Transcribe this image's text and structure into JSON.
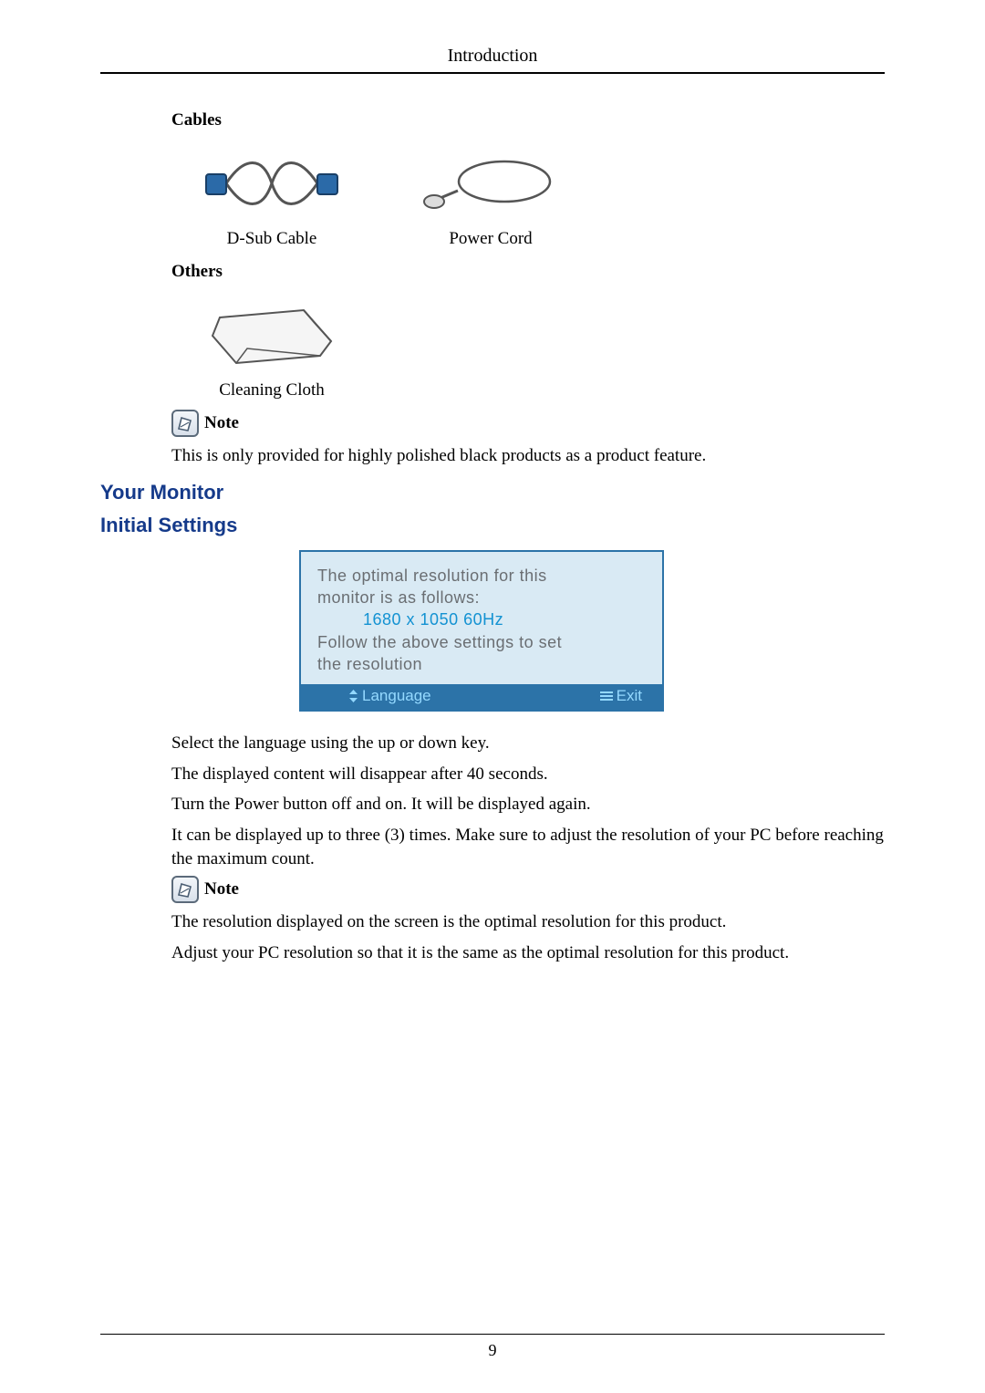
{
  "header": {
    "title": "Introduction"
  },
  "footer": {
    "page_number": "9"
  },
  "cables": {
    "heading": "Cables",
    "items": [
      {
        "caption": "D-Sub Cable"
      },
      {
        "caption": "Power Cord"
      }
    ]
  },
  "others": {
    "heading": "Others",
    "items": [
      {
        "caption": "Cleaning Cloth"
      }
    ]
  },
  "note1": {
    "label": "Note",
    "text": "This is only provided for highly polished black products as a product feature."
  },
  "h2a": "Your Monitor",
  "h2b": "Initial Settings",
  "osd": {
    "line1": "The optimal resolution for this",
    "line2": "monitor is as follows:",
    "resolution": "1680 x 1050 60Hz",
    "line3": "Follow the above settings to set",
    "line4": "the resolution",
    "footer_left": "Language",
    "footer_right": "Exit"
  },
  "paras": {
    "p1": "Select the language using the up or down key.",
    "p2": "The displayed content will disappear after 40 seconds.",
    "p3": "Turn the Power button off and on. It will be displayed again.",
    "p4": "It can be displayed up to three (3) times. Make sure to adjust the resolution of your PC before reaching the maximum count."
  },
  "note2": {
    "label": "Note",
    "text1": "The resolution displayed on the screen is the optimal resolution for this product.",
    "text2": "Adjust your PC resolution so that it is the same as the optimal resolution for this product."
  }
}
